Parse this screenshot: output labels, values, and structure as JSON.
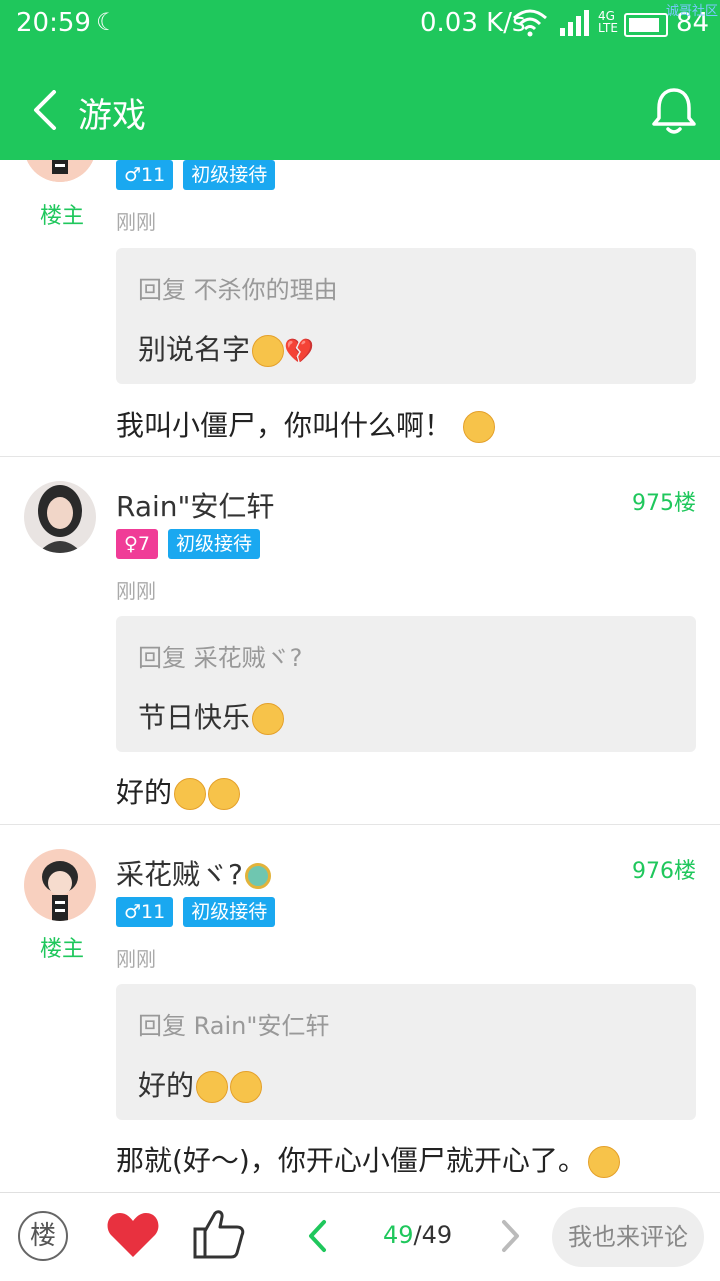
{
  "status_bar": {
    "time": "20:59",
    "network_speed": "0.03 K/s",
    "network_type": "4G",
    "battery": "84",
    "watermark": "诚哥社区"
  },
  "nav": {
    "title": "游戏"
  },
  "posts": [
    {
      "owner_label": "楼主",
      "gender": "♂11",
      "level": "初级接待",
      "time": "刚刚",
      "quote_header": "回复 不杀你的理由",
      "quote_body": "别说名字",
      "content": "我叫小僵尸，你叫什么啊！"
    },
    {
      "name": "Rain\"安仁轩",
      "floor": "975楼",
      "gender": "♀7",
      "level": "初级接待",
      "time": "刚刚",
      "quote_header": "回复 采花贼ヾ?",
      "quote_body": "节日快乐",
      "content": "好的"
    },
    {
      "name": "采花贼ヾ?",
      "owner_label": "楼主",
      "floor": "976楼",
      "gender": "♂11",
      "level": "初级接待",
      "time": "刚刚",
      "quote_header": "回复 Rain\"安仁轩",
      "quote_body": "好的",
      "content": "那就(好～)，你开心小僵尸就开心了。"
    }
  ],
  "bottom_bar": {
    "floor_button": "楼",
    "page_current": "49",
    "page_total": "/49",
    "comment_placeholder": "我也来评论"
  },
  "colors": {
    "brand_green": "#1fc75c",
    "badge_blue": "#1aa8f0",
    "badge_pink": "#f03c97",
    "like_red": "#e8313f"
  }
}
